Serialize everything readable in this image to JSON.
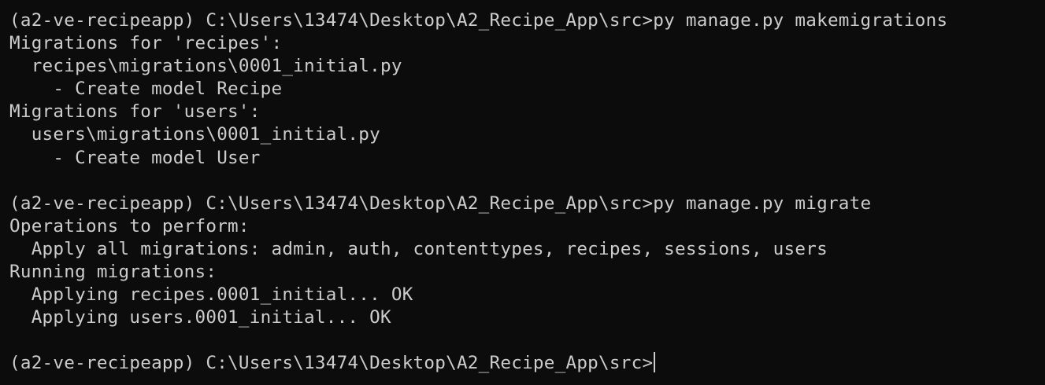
{
  "terminal": {
    "lines": [
      "(a2-ve-recipeapp) C:\\Users\\13474\\Desktop\\A2_Recipe_App\\src>py manage.py makemigrations",
      "Migrations for 'recipes':",
      "  recipes\\migrations\\0001_initial.py",
      "    - Create model Recipe",
      "Migrations for 'users':",
      "  users\\migrations\\0001_initial.py",
      "    - Create model User",
      "",
      "(a2-ve-recipeapp) C:\\Users\\13474\\Desktop\\A2_Recipe_App\\src>py manage.py migrate",
      "Operations to perform:",
      "  Apply all migrations: admin, auth, contenttypes, recipes, sessions, users",
      "Running migrations:",
      "  Applying recipes.0001_initial... OK",
      "  Applying users.0001_initial... OK",
      ""
    ],
    "prompt": "(a2-ve-recipeapp) C:\\Users\\13474\\Desktop\\A2_Recipe_App\\src>",
    "text_color": "#cccccc",
    "background_color": "#0c0c0c"
  }
}
